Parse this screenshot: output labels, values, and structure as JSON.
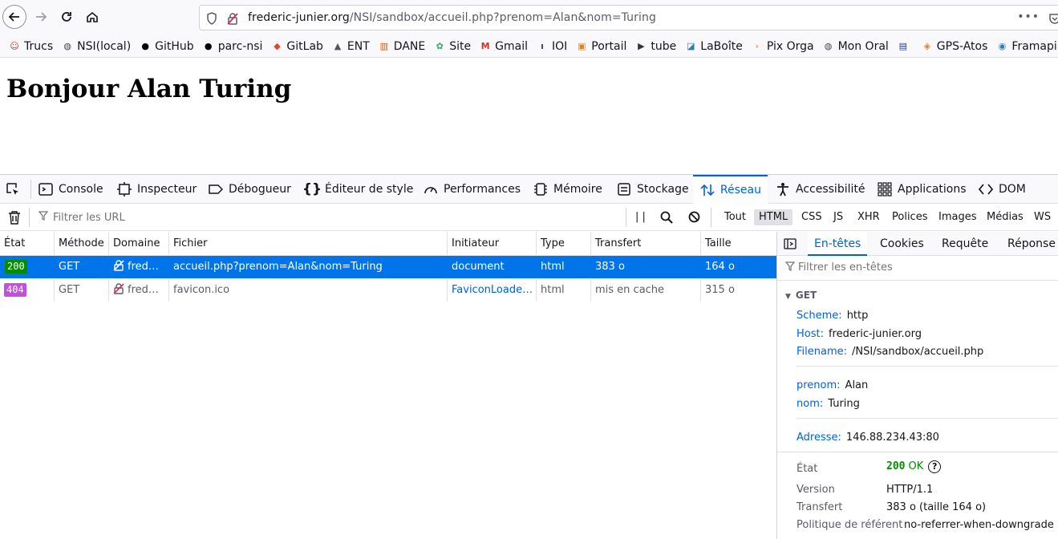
{
  "address_bar": {
    "url_host": "frederic-junier.org",
    "url_path": "/NSI/sandbox/accueil.php?prenom=Alan&nom=Turing",
    "more": "•••"
  },
  "bookmarks": [
    {
      "label": "Trucs",
      "icon": "person-icon",
      "color": "#c0392b"
    },
    {
      "label": "NSI(local)",
      "icon": "globe-icon",
      "color": "#444"
    },
    {
      "label": "GitHub",
      "icon": "github-icon",
      "color": "#000"
    },
    {
      "label": "parc-nsi",
      "icon": "github-icon",
      "color": "#000"
    },
    {
      "label": "GitLab",
      "icon": "gitlab-icon",
      "color": "#e24329"
    },
    {
      "label": "ENT",
      "icon": "ent-icon",
      "color": "#555"
    },
    {
      "label": "DANE",
      "icon": "dane-icon",
      "color": "#d35400"
    },
    {
      "label": "Site",
      "icon": "site-icon",
      "color": "#27ae60"
    },
    {
      "label": "Gmail",
      "icon": "gmail-icon",
      "color": "#d93025"
    },
    {
      "label": "IOI",
      "icon": "ioi-icon",
      "color": "#2c3e99"
    },
    {
      "label": "Portail",
      "icon": "portail-icon",
      "color": "#e67e22"
    },
    {
      "label": "tube",
      "icon": "play-icon",
      "color": "#333"
    },
    {
      "label": "LaBoîte",
      "icon": "laboite-icon",
      "color": "#2980b9"
    },
    {
      "label": "Pix Orga",
      "icon": "chevron-right-icon",
      "color": "#f39c12"
    },
    {
      "label": "Mon Oral",
      "icon": "globe-icon",
      "color": "#444"
    },
    {
      "label": "",
      "icon": "book-icon",
      "color": "#1f3a93"
    },
    {
      "label": "GPS-Atos",
      "icon": "gps-icon",
      "color": "#e67e22"
    },
    {
      "label": "Framapi",
      "icon": "framapi-icon",
      "color": "#2980b9"
    }
  ],
  "page": {
    "heading": "Bonjour Alan Turing"
  },
  "devtools": {
    "tabs": [
      "Console",
      "Inspecteur",
      "Débogueur",
      "Éditeur de style",
      "Performances",
      "Mémoire",
      "Stockage",
      "Réseau",
      "Accessibilité",
      "Applications",
      "DOM"
    ],
    "active_tab": "Réseau",
    "filter_placeholder": "Filtrer les URL",
    "pause_label": "| |",
    "type_filters": [
      "Tout",
      "HTML",
      "CSS",
      "JS",
      "XHR",
      "Polices",
      "Images",
      "Médias",
      "WS"
    ],
    "active_type_filter": "HTML",
    "columns": [
      "État",
      "Méthode",
      "Domaine",
      "Fichier",
      "Initiateur",
      "Type",
      "Transfert",
      "Taille"
    ],
    "requests": [
      {
        "status": "200",
        "status_color": "#058b00",
        "method": "GET",
        "domain": "fred…",
        "file": "accueil.php?prenom=Alan&nom=Turing",
        "initiator": "document",
        "type": "html",
        "transfer": "383 o",
        "size": "164 o"
      },
      {
        "status": "404",
        "status_color": "#c34fdc",
        "method": "GET",
        "domain": "fred…",
        "file": "favicon.ico",
        "initiator": "FaviconLoader…",
        "type": "html",
        "transfer": "mis en cache",
        "size": "315 o"
      }
    ],
    "side_panel": {
      "tabs": [
        "En-têtes",
        "Cookies",
        "Requête",
        "Réponse"
      ],
      "active_tab": "En-têtes",
      "filter_placeholder": "Filtrer les en-têtes",
      "method_heading": "GET",
      "scheme_label": "Scheme:",
      "scheme": "http",
      "host_label": "Host:",
      "host": "frederic-junier.org",
      "filename_label": "Filename:",
      "filename": "/NSI/sandbox/accueil.php",
      "params": [
        {
          "label": "prenom:",
          "value": "Alan"
        },
        {
          "label": "nom:",
          "value": "Turing"
        }
      ],
      "address_label": "Adresse:",
      "address": "146.88.234.43:80",
      "status_label": "État",
      "status_code": "200",
      "status_text": "OK",
      "version_label": "Version",
      "version": "HTTP/1.1",
      "transfer_label": "Transfert",
      "transfer": "383 o (taille 164 o)",
      "referrer_label": "Politique de référent",
      "referrer": "no-referrer-when-downgrade"
    }
  }
}
